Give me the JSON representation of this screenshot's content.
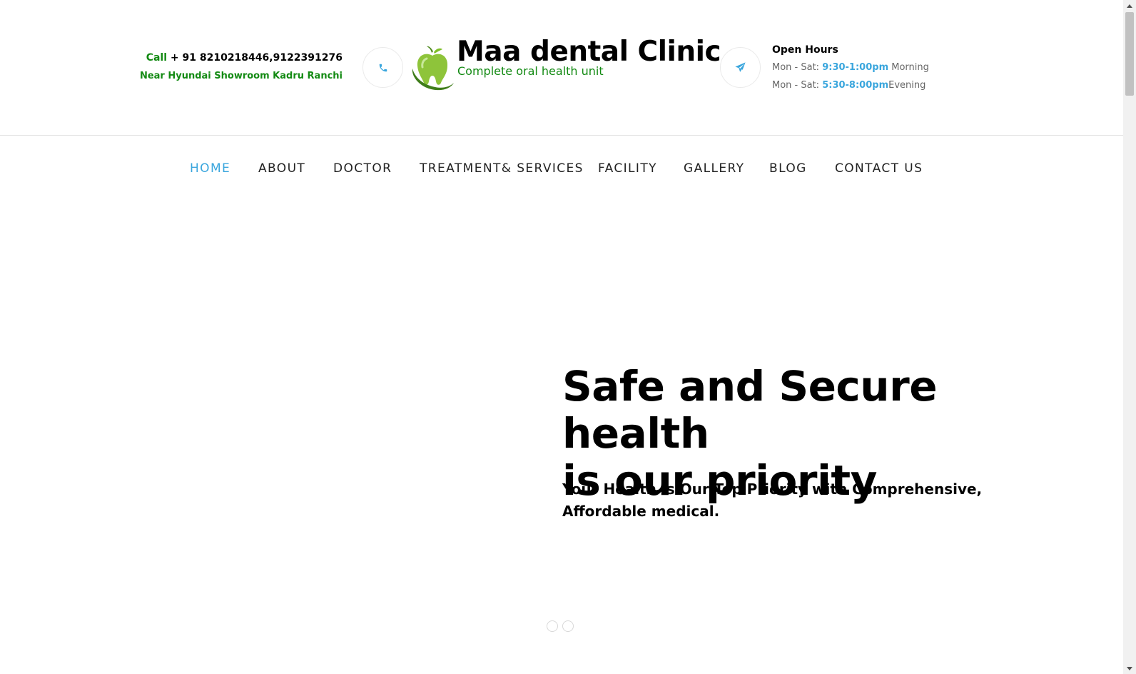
{
  "header": {
    "call_label": "Call",
    "phone_numbers": "+ 91 8210218446,9122391276",
    "address": "Near Hyundai Showroom Kadru Ranchi",
    "phone_icon": "phone-icon",
    "send_icon": "paper-plane-icon",
    "logo": {
      "title": "Maa dental Clinic",
      "subtitle": "Complete oral health unit",
      "icon": "tooth-apple-icon"
    },
    "hours": {
      "title": "Open Hours",
      "rows": [
        {
          "prefix": "Mon - Sat: ",
          "time": "9:30-1:00pm",
          "suffix": " Morning"
        },
        {
          "prefix": "Mon - Sat: ",
          "time": "5:30-8:00pm",
          "suffix": "Evening"
        }
      ]
    }
  },
  "nav": {
    "items": [
      {
        "label": "HOME",
        "active": true
      },
      {
        "label": "ABOUT",
        "active": false
      },
      {
        "label": "DOCTOR",
        "active": false
      },
      {
        "label": "TREATMENT& SERVICES",
        "active": false
      },
      {
        "label": "FACILITY",
        "active": false
      },
      {
        "label": "GALLERY",
        "active": false
      },
      {
        "label": "BLOG",
        "active": false
      },
      {
        "label": "CONTACT US",
        "active": false
      }
    ]
  },
  "hero": {
    "title_line1": "Safe and Secure health",
    "title_line2": "is our priority",
    "subtitle": "Your Health is Our Top Priority with Comprehensive, Affordable medical.",
    "slides_count": 2
  },
  "colors": {
    "accent": "#3aa6dd",
    "brand_green": "#138a13",
    "text": "#000000"
  }
}
